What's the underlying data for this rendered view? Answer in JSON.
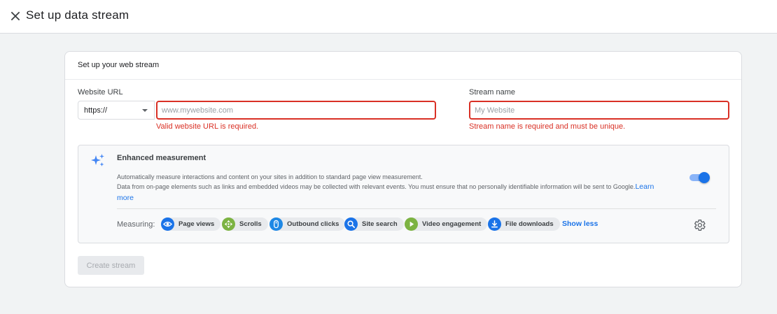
{
  "header": {
    "title": "Set up data stream",
    "close_icon": "close-icon"
  },
  "card": {
    "title": "Set up your web stream",
    "website_url": {
      "label": "Website URL",
      "protocol_value": "https://",
      "placeholder": "www.mywebsite.com",
      "value": "",
      "error": "Valid website URL is required."
    },
    "stream_name": {
      "label": "Stream name",
      "placeholder": "My Website",
      "value": "",
      "error": "Stream name is required and must be unique."
    },
    "enhanced": {
      "icon": "sparkle-icon",
      "title": "Enhanced measurement",
      "desc_line1": "Automatically measure interactions and content on your sites in addition to standard page view measurement.",
      "desc_line2": "Data from on-page elements such as links and embedded videos may be collected with relevant events. You must ensure that no personally identifiable information will be sent to Google.",
      "learn_more_1": "Learn",
      "learn_more_2": "more",
      "toggle_on": true,
      "measuring_label": "Measuring:",
      "chips": [
        {
          "label": "Page views",
          "icon": "eye-icon",
          "color": "#1a73e8"
        },
        {
          "label": "Scrolls",
          "icon": "scroll-arrows-icon",
          "color": "#7cb342"
        },
        {
          "label": "Outbound clicks",
          "icon": "mouse-icon",
          "color": "#1e88e5"
        },
        {
          "label": "Site search",
          "icon": "search-icon",
          "color": "#1a73e8"
        },
        {
          "label": "Video engagement",
          "icon": "play-icon",
          "color": "#7cb342"
        },
        {
          "label": "File downloads",
          "icon": "download-icon",
          "color": "#1a73e8"
        }
      ],
      "show_less": "Show less",
      "settings_icon": "gear-icon"
    },
    "create_button": "Create stream"
  },
  "colors": {
    "accent": "#1a73e8",
    "error": "#d93025",
    "background": "#f1f3f4"
  }
}
